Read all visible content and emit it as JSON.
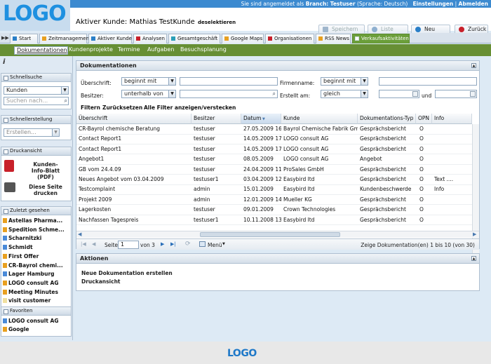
{
  "logo": "LOGO",
  "topbar": {
    "prefix": "Sie sind angemeldet als",
    "branch_label": "Branch:",
    "branch": "Testuser",
    "lang": "(Sprache: Deutsch)",
    "settings": "Einstellungen",
    "sep": "|",
    "logout": "Abmelden"
  },
  "header": {
    "title_label": "Aktiver Kunde:",
    "title_value": "Mathias TestKunde",
    "deselect": "deselektieren",
    "buttons": {
      "save": "Speichern",
      "list": "Liste",
      "new": "Neu",
      "back": "Zurück"
    }
  },
  "tabs": [
    {
      "label": "Start",
      "color": "#2a7fc8"
    },
    {
      "label": "Zeitmanagement",
      "color": "#e8a020"
    },
    {
      "label": "Aktiver Kunde",
      "color": "#2a7fc8"
    },
    {
      "label": "Analysen",
      "color": "#c8202a"
    },
    {
      "label": "Gesamtgeschäft",
      "color": "#2a9fb8"
    },
    {
      "label": "Google Maps",
      "color": "#e8a020"
    },
    {
      "label": "Organisationen",
      "color": "#c8202a"
    },
    {
      "label": "RSS News",
      "color": "#e8a020"
    },
    {
      "label": "Verkaufsaktivitäten",
      "color": "#ffffff"
    }
  ],
  "subnav": [
    "Dokumentationen",
    "Kundenprojekte",
    "Termine",
    "Aufgaben",
    "Besuchsplanung"
  ],
  "sidebar": {
    "info": "i",
    "quicksearch": {
      "title": "Schnellsuche",
      "select": "Kunden",
      "placeholder": "Suchen nach..."
    },
    "quickcreate": {
      "title": "Schnellerstellung",
      "select": "Erstellen..."
    },
    "print": {
      "title": "Druckansicht",
      "item1": "Kunden-Info-Blatt (PDF)",
      "item1a": "Kunden-",
      "item1b": "Info-Blatt (PDF)",
      "item2a": "Diese Seite",
      "item2b": "drucken"
    },
    "recent": {
      "title": "Zuletzt gesehen",
      "items": [
        {
          "label": "Astellas Pharma...",
          "c": "#e8a020"
        },
        {
          "label": "Spedition Schme...",
          "c": "#e8a020"
        },
        {
          "label": "Scharnitzki",
          "c": "#4a8ad8"
        },
        {
          "label": "Schmidt",
          "c": "#4a8ad8"
        },
        {
          "label": "First Offer",
          "c": "#e8a020"
        },
        {
          "label": "CR-Bayrol chemi...",
          "c": "#e8a020"
        },
        {
          "label": "Lager Hamburg",
          "c": "#4a8ad8"
        },
        {
          "label": "LOGO consult AG",
          "c": "#e8a020"
        },
        {
          "label": "Meeting Minutes",
          "c": "#e8a020"
        },
        {
          "label": "visit customer",
          "c": "#f0e0a0"
        }
      ]
    },
    "favorites": {
      "title": "Favoriten",
      "items": [
        {
          "label": "LOGO consult AG",
          "c": "#4a8ad8"
        },
        {
          "label": "Google",
          "c": "#e8a020"
        }
      ]
    }
  },
  "docs": {
    "title": "Dokumentationen",
    "filter": {
      "subject_label": "Überschrift:",
      "subject_op": "beginnt mit",
      "owner_label": "Besitzer:",
      "owner_op": "unterhalb von",
      "company_label": "Firmenname:",
      "company_op": "beginnt mit",
      "created_label": "Erstellt am:",
      "created_op": "gleich",
      "and": "und",
      "links": [
        "Filtern",
        "Zurücksetzen",
        "Alle Filter anzeigen/verstecken"
      ]
    },
    "columns": [
      "Überschrift",
      "Besitzer",
      "Datum",
      "Kunde",
      "Dokumentations-Typ",
      "OPN",
      "Info"
    ],
    "rows": [
      [
        "CR-Bayrol chemische Beratung",
        "testuser",
        "27.05.2009 16:",
        "Bayrol Chemische Fabrik GmbH",
        "Gesprächsbericht",
        "O",
        ""
      ],
      [
        "Contact Report1",
        "testuser",
        "14.05.2009 17:",
        "LOGO consult AG",
        "Gesprächsbericht",
        "O",
        ""
      ],
      [
        "Contact Report1",
        "testuser",
        "14.05.2009 17:",
        "LOGO consult AG",
        "Gesprächsbericht",
        "O",
        ""
      ],
      [
        "Angebot1",
        "testuser",
        "08.05.2009",
        "LOGO consult AG",
        "Angebot",
        "O",
        ""
      ],
      [
        "GB vom 24.4.09",
        "testuser",
        "24.04.2009 11:",
        "ProSales GmbH",
        "Gesprächsbericht",
        "O",
        ""
      ],
      [
        "Neues Angebot vom 03.04.2009",
        "testuser1",
        "03.04.2009 12:",
        "Easybird ltd",
        "Gesprächsbericht",
        "O",
        "Text ...."
      ],
      [
        "Testcomplaint",
        "admin",
        "15.01.2009",
        "Easybird ltd",
        "Kundenbeschwerde",
        "O",
        "Info"
      ],
      [
        "Projekt 2009",
        "admin",
        "12.01.2009 14:",
        "Mueller KG",
        "Gesprächsbericht",
        "O",
        ""
      ],
      [
        "Lagerkosten",
        "testuser",
        "09.01.2009",
        "Crown Technologies",
        "Gesprächsbericht",
        "O",
        ""
      ],
      [
        "Nachfassen Tagespreis",
        "testuser1",
        "10.11.2008 13:",
        "Easybird ltd",
        "Gesprächsbericht",
        "O",
        ""
      ]
    ],
    "pager": {
      "page_label": "Seite",
      "page": "1",
      "of": "von 3",
      "menu": "Menü",
      "summary": "Zeige Dokumentation(en) 1 bis 10 (von 30)"
    }
  },
  "actions": {
    "title": "Aktionen",
    "items": [
      "Neue Dokumentation erstellen",
      "Druckansicht"
    ]
  },
  "footer": {
    "logo": "LOGO"
  }
}
